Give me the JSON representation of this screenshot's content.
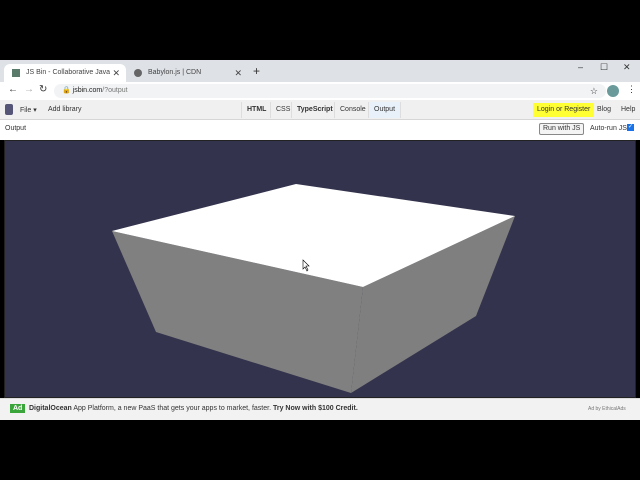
{
  "browser": {
    "tabs": [
      {
        "title": "JS Bin - Collaborative JavaScript Debugging",
        "active": true
      },
      {
        "title": "Babylon.js | CDN",
        "active": false
      }
    ],
    "url_host": "jsbin.com",
    "url_path": "/?output"
  },
  "jsbin": {
    "file": "File",
    "add_library": "Add library",
    "panels": [
      "HTML",
      "CSS",
      "TypeScript",
      "Console",
      "Output"
    ],
    "login": "Login or Register",
    "blog": "Blog",
    "help": "Help"
  },
  "output": {
    "label": "Output",
    "run_button": "Run with JS",
    "autorun_label": "Auto-run JS",
    "autorun_checked": true
  },
  "ad": {
    "badge": "Ad",
    "brand": "DigitalOcean",
    "text": " App Platform, a new PaaS that gets your apps to market, faster. ",
    "cta": "Try Now with $100 Credit.",
    "attribution": "Ad by EthicalAds"
  },
  "colors": {
    "scene_bg": "#33334d",
    "highlight": "#ffff33"
  }
}
